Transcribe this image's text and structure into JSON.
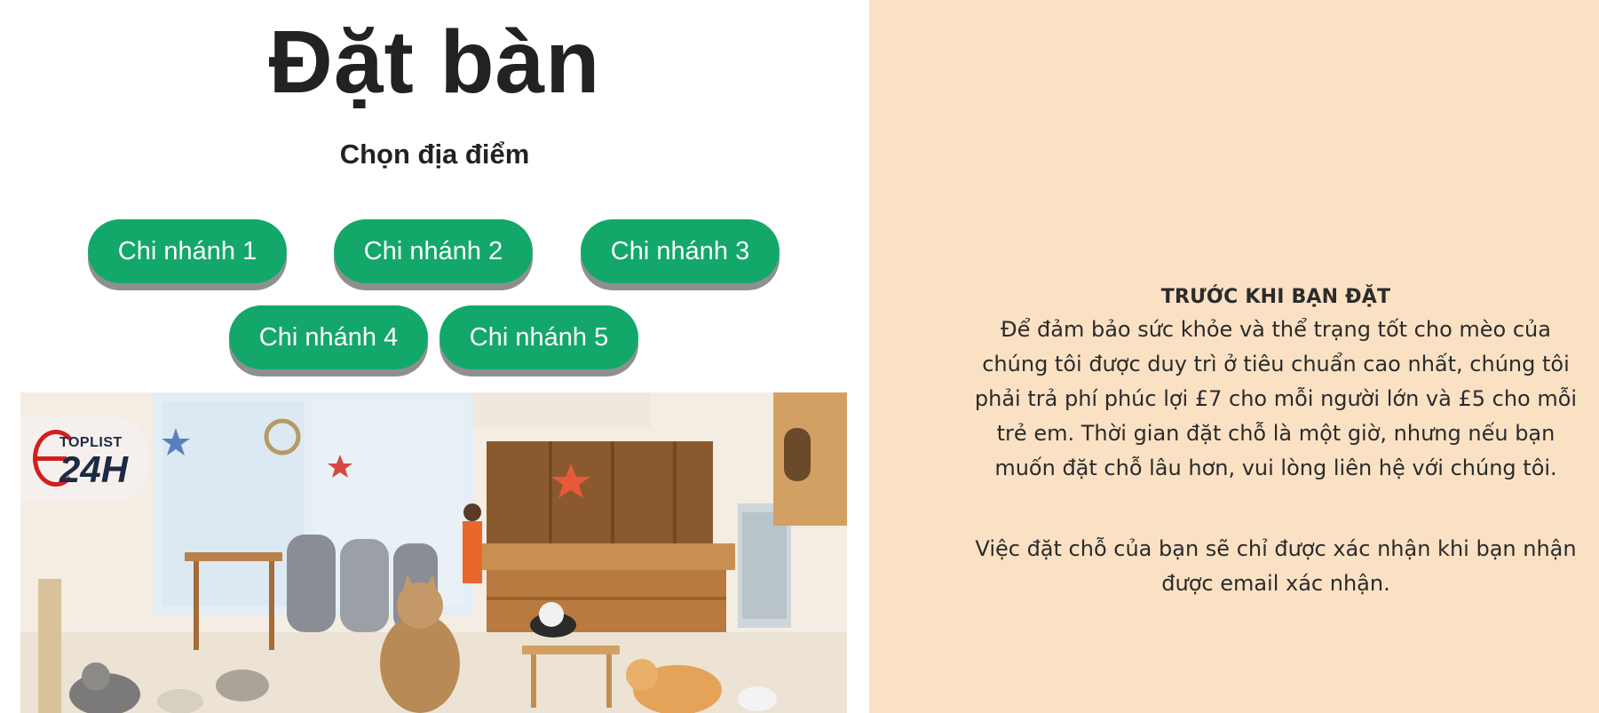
{
  "booking": {
    "title": "Đặt bàn",
    "subtitle": "Chọn địa điểm",
    "branches": [
      "Chi nhánh 1",
      "Chi nhánh 2",
      "Chi nhánh 3",
      "Chi nhánh 4",
      "Chi nhánh 5"
    ]
  },
  "photo": {
    "logo_top": "TOPLIST",
    "logo_main": "24H"
  },
  "notice": {
    "heading": "TRƯỚC KHI BẠN ĐẶT",
    "paragraph_1": "Để đảm bảo sức khỏe và thể trạng tốt cho mèo của chúng tôi được duy trì ở tiêu chuẩn cao nhất, chúng tôi phải trả phí phúc lợi £7 cho mỗi người lớn và £5 cho mỗi trẻ em. Thời gian đặt chỗ là một giờ, nhưng nếu bạn muốn đặt chỗ lâu hơn, vui lòng liên hệ với chúng tôi.",
    "paragraph_2": "Việc đặt chỗ của bạn sẽ chỉ được xác nhận khi bạn nhận được email xác nhận."
  },
  "colors": {
    "button": "#13a86a",
    "button_shadow": "#8f8f8f",
    "right_panel": "#fbe1c4",
    "text": "#222222"
  }
}
